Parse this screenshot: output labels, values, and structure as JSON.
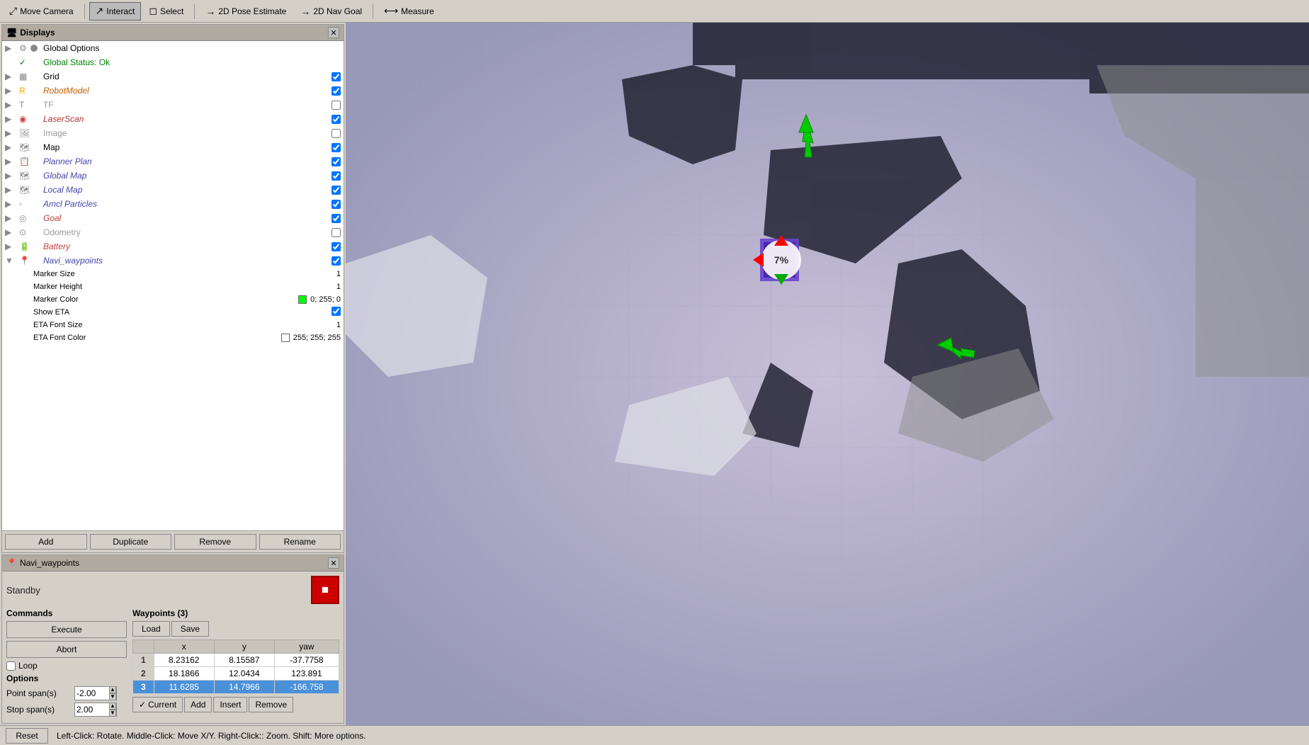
{
  "toolbar": {
    "buttons": [
      {
        "id": "move-camera",
        "label": "Move Camera",
        "icon": "↕",
        "active": false
      },
      {
        "id": "interact",
        "label": "Interact",
        "icon": "↗",
        "active": true
      },
      {
        "id": "select",
        "label": "Select",
        "icon": "◻",
        "active": false
      },
      {
        "id": "2d-pose",
        "label": "2D Pose Estimate",
        "icon": "→",
        "active": false
      },
      {
        "id": "2d-nav",
        "label": "2D Nav Goal",
        "icon": "→",
        "active": false
      },
      {
        "id": "measure",
        "label": "Measure",
        "icon": "⟷",
        "active": false
      }
    ]
  },
  "displays": {
    "title": "Displays",
    "items": [
      {
        "id": "global-options",
        "label": "Global Options",
        "icon": "⚙",
        "has_expand": true,
        "checked": null,
        "level": 0
      },
      {
        "id": "global-status",
        "label": "Global Status: Ok",
        "icon": "✓",
        "has_expand": false,
        "checked": null,
        "level": 0
      },
      {
        "id": "grid",
        "label": "Grid",
        "icon": "▦",
        "has_expand": true,
        "checked": true,
        "level": 0
      },
      {
        "id": "robot-model",
        "label": "RobotModel",
        "icon": "🤖",
        "has_expand": true,
        "checked": true,
        "level": 0
      },
      {
        "id": "tf",
        "label": "TF",
        "icon": "T",
        "has_expand": true,
        "checked": false,
        "level": 0
      },
      {
        "id": "laser-scan",
        "label": "LaserScan",
        "icon": "◉",
        "has_expand": true,
        "checked": true,
        "level": 0
      },
      {
        "id": "image",
        "label": "Image",
        "icon": "🖼",
        "has_expand": true,
        "checked": false,
        "level": 0
      },
      {
        "id": "map",
        "label": "Map",
        "icon": "🗺",
        "has_expand": true,
        "checked": true,
        "level": 0
      },
      {
        "id": "planner-plan",
        "label": "Planner Plan",
        "icon": "📋",
        "has_expand": true,
        "checked": true,
        "level": 0
      },
      {
        "id": "global-map",
        "label": "Global Map",
        "icon": "🗺",
        "has_expand": true,
        "checked": true,
        "level": 0
      },
      {
        "id": "local-map",
        "label": "Local Map",
        "icon": "🗺",
        "has_expand": true,
        "checked": true,
        "level": 0
      },
      {
        "id": "amcl-particles",
        "label": "Amcl Particles",
        "icon": "◦",
        "has_expand": true,
        "checked": true,
        "level": 0
      },
      {
        "id": "goal",
        "label": "Goal",
        "icon": "◎",
        "has_expand": true,
        "checked": true,
        "level": 0
      },
      {
        "id": "odometry",
        "label": "Odometry",
        "icon": "⊙",
        "has_expand": true,
        "checked": false,
        "level": 0
      },
      {
        "id": "battery",
        "label": "Battery",
        "icon": "🔋",
        "has_expand": true,
        "checked": true,
        "level": 0
      },
      {
        "id": "navi-waypoints",
        "label": "Navi_waypoints",
        "icon": "📍",
        "has_expand": true,
        "checked": true,
        "level": 0,
        "expanded": true
      }
    ],
    "subitems": [
      {
        "label": "Marker Size",
        "value": "1"
      },
      {
        "label": "Marker Height",
        "value": "1"
      },
      {
        "label": "Marker Color",
        "value": "0; 255; 0",
        "color": "#00ff00"
      },
      {
        "label": "Show ETA",
        "value": "✓"
      },
      {
        "label": "ETA Font Size",
        "value": "1"
      },
      {
        "label": "ETA Font Color",
        "value": "255; 255; 255",
        "color": "#ffffff"
      }
    ],
    "footer_buttons": [
      "Add",
      "Duplicate",
      "Remove",
      "Rename"
    ]
  },
  "navi_panel": {
    "title": "Navi_waypoints",
    "status": "Standby",
    "commands_label": "Commands",
    "execute_label": "Execute",
    "abort_label": "Abort",
    "loop_label": "Loop",
    "options_label": "Options",
    "point_span_label": "Point span(s)",
    "point_span_value": "-2.00",
    "stop_span_label": "Stop span(s)",
    "stop_span_value": "2.00",
    "waypoints_label": "Waypoints (3)",
    "load_label": "Load",
    "save_label": "Save",
    "waypoints": [
      {
        "num": "1",
        "x": "8.23162",
        "y": "8.15587",
        "yaw": "-37.7758"
      },
      {
        "num": "2",
        "x": "18.1866",
        "y": "12.0434",
        "yaw": "123.891"
      },
      {
        "num": "3",
        "x": "11.6285",
        "y": "14.7966",
        "yaw": "-166.758"
      }
    ],
    "selected_row": 3,
    "col_x": "x",
    "col_y": "y",
    "col_yaw": "yaw",
    "current_label": "Current",
    "add_label": "Add",
    "insert_label": "Insert",
    "remove_label": "Remove"
  },
  "status_bar": {
    "reset_label": "Reset",
    "hint": "Left-Click: Rotate.  Middle-Click: Move X/Y.  Right-Click:: Zoom.  Shift: More options."
  },
  "icons": {
    "close": "✕",
    "expand_right": "▶",
    "expand_down": "▼",
    "check": "✓",
    "stop": "⏹"
  }
}
